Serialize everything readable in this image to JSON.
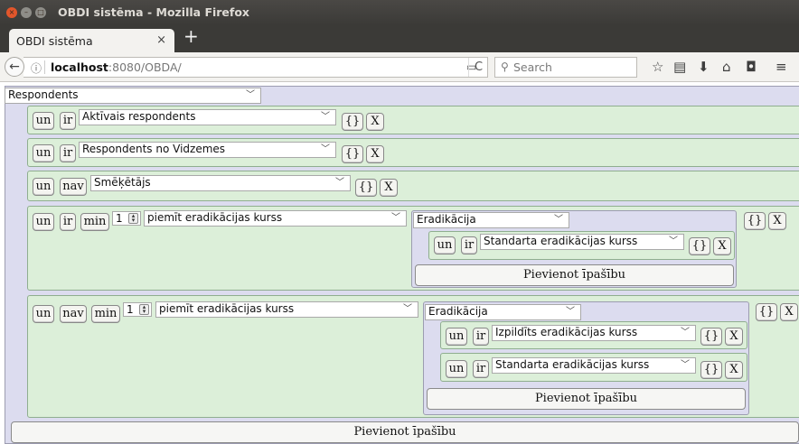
{
  "window": {
    "title": "OBDI sistēma - Mozilla Firefox"
  },
  "tab": {
    "title": "OBDI sistēma",
    "close": "×",
    "new": "+"
  },
  "navbar": {
    "back": "←",
    "info": "ⓘ",
    "url_host": "localhost",
    "url_rest": ":8080/OBDA/",
    "reader": "▭",
    "reload": "C",
    "search_placeholder": "Search",
    "search_icon": "⚲",
    "icons": {
      "bookmark": "☆",
      "library": "▤",
      "download": "⬇",
      "home": "⌂",
      "pocket": "◘",
      "menu": "≡"
    }
  },
  "query": {
    "root_select": "Respondents",
    "rows": [
      {
        "conj": "un",
        "op": "ir",
        "property": "Aktīvais respondents",
        "braces": "{}",
        "remove": "X"
      },
      {
        "conj": "un",
        "op": "ir",
        "property": "Respondents no Vidzemes",
        "braces": "{}",
        "remove": "X"
      },
      {
        "conj": "un",
        "op": "nav",
        "property": "Smēķētājs",
        "braces": "{}",
        "remove": "X"
      },
      {
        "conj": "un",
        "op": "ir",
        "quant": "min",
        "count": "1",
        "property": "piemīt eradikācijas kurss",
        "braces": "{}",
        "remove": "X",
        "sub": {
          "select": "Eradikācija",
          "rows": [
            {
              "conj": "un",
              "op": "ir",
              "property": "Standarta eradikācijas kurss",
              "braces": "{}",
              "remove": "X"
            }
          ],
          "add": "Pievienot īpašību"
        }
      },
      {
        "conj": "un",
        "op": "nav",
        "quant": "min",
        "count": "1",
        "property": "piemīt eradikācijas kurss",
        "braces": "{}",
        "remove": "X",
        "sub": {
          "select": "Eradikācija",
          "rows": [
            {
              "conj": "un",
              "op": "ir",
              "property": "Izpildīts eradikācijas kurss",
              "braces": "{}",
              "remove": "X"
            },
            {
              "conj": "un",
              "op": "ir",
              "property": "Standarta eradikācijas kurss",
              "braces": "{}",
              "remove": "X"
            }
          ],
          "add": "Pievienot īpašību"
        }
      }
    ],
    "add": "Pievienot īpašību"
  },
  "colors": {
    "outer_panel": "#dcdcef",
    "row_panel": "#dcefd9",
    "titlebar": "#3b3a37",
    "close_button": "#e2562b"
  }
}
